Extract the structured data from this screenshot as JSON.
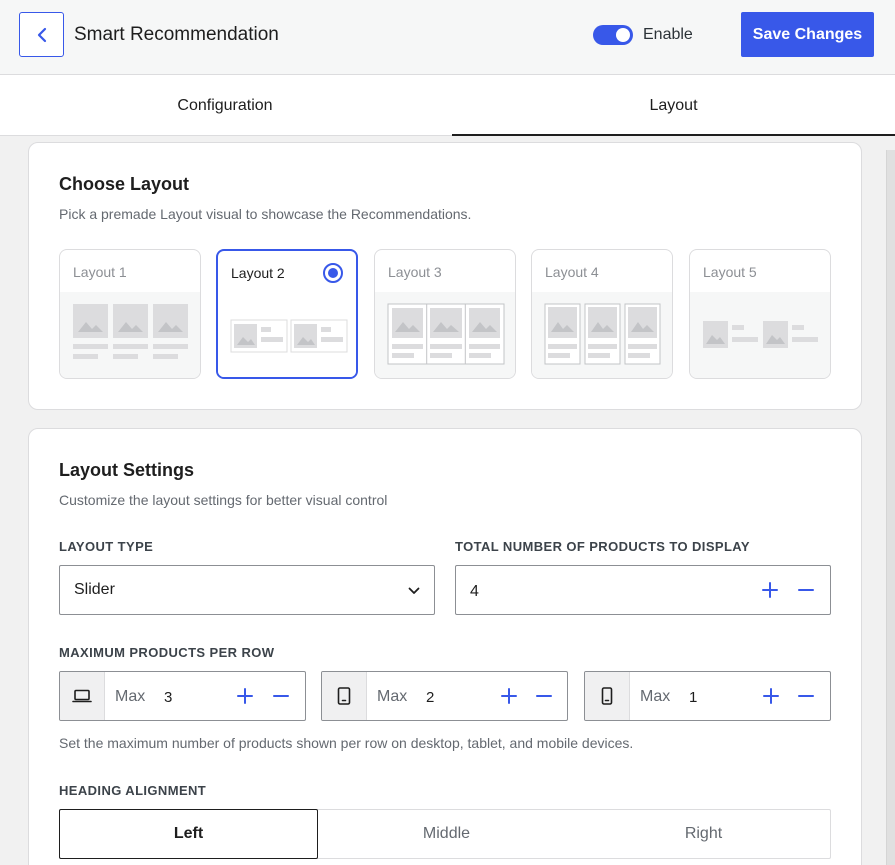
{
  "header": {
    "title": "Smart Recommendation",
    "enable_label": "Enable",
    "enabled": true,
    "save_label": "Save Changes"
  },
  "tabs": [
    {
      "label": "Configuration",
      "active": false
    },
    {
      "label": "Layout",
      "active": true
    }
  ],
  "choose_layout": {
    "title": "Choose Layout",
    "description": "Pick a premade Layout visual to showcase the Recommendations.",
    "options": [
      {
        "label": "Layout 1",
        "selected": false
      },
      {
        "label": "Layout 2",
        "selected": true
      },
      {
        "label": "Layout 3",
        "selected": false
      },
      {
        "label": "Layout 4",
        "selected": false
      },
      {
        "label": "Layout 5",
        "selected": false
      }
    ]
  },
  "layout_settings": {
    "title": "Layout Settings",
    "description": "Customize the layout settings for better visual control",
    "layout_type_label": "LAYOUT TYPE",
    "layout_type_value": "Slider",
    "total_products_label": "TOTAL NUMBER OF PRODUCTS TO DISPLAY",
    "total_products_value": "4",
    "max_per_row_label": "MAXIMUM PRODUCTS PER ROW",
    "max_prefix": "Max",
    "devices": [
      {
        "device": "desktop",
        "icon": "laptop-icon",
        "value": "3"
      },
      {
        "device": "tablet",
        "icon": "tablet-icon",
        "value": "2"
      },
      {
        "device": "mobile",
        "icon": "mobile-icon",
        "value": "1"
      }
    ],
    "max_per_row_hint": "Set the maximum number of products shown per row on desktop, tablet, and mobile devices.",
    "heading_alignment_label": "HEADING ALIGNMENT",
    "alignment_options": [
      "Left",
      "Middle",
      "Right"
    ],
    "alignment_selected": "Left"
  },
  "colors": {
    "accent": "#3858e9",
    "text": "#1e1e1e",
    "muted": "#646970",
    "border": "#dcdcde"
  }
}
